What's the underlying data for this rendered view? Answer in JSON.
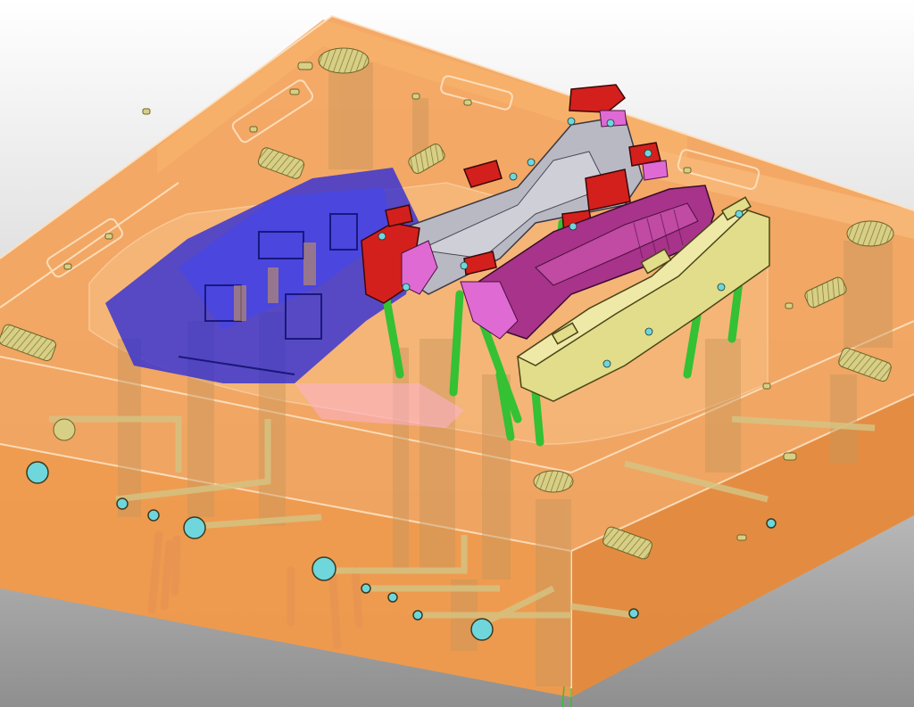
{
  "scene": {
    "subject": "mold-assembly-3d-render",
    "background": {
      "top": "#ffffff",
      "mid": "#d2d2d2",
      "bottom": "#8f8f8f"
    }
  },
  "palette": {
    "mold_plate": "#f09a4c",
    "mold_plate_light": "#f6b06a",
    "mold_plate_dark": "#d9823a",
    "edge_line": "#fde2c2",
    "insert_blue": "#2a2ad8",
    "slider_red": "#d4201c",
    "core_purple": "#a8338a",
    "insert_gray": "#b9b9c4",
    "accent_pink": "#e06ad4",
    "slider_yellow": "#e2dd8a",
    "rod_green": "#34c134",
    "fitting_tan": "#d8cf86",
    "pin_dark_blue": "#1a28c6",
    "port_cyan": "#6fd6dc"
  },
  "components": [
    "mold-base-plate",
    "blue-cavity-insert",
    "red-slider-blocks",
    "purple-core-insert",
    "gray-core-insert",
    "yellow-slider-block",
    "green-guide-rods",
    "cooling-channels",
    "threaded-fittings",
    "ejector-pins"
  ]
}
